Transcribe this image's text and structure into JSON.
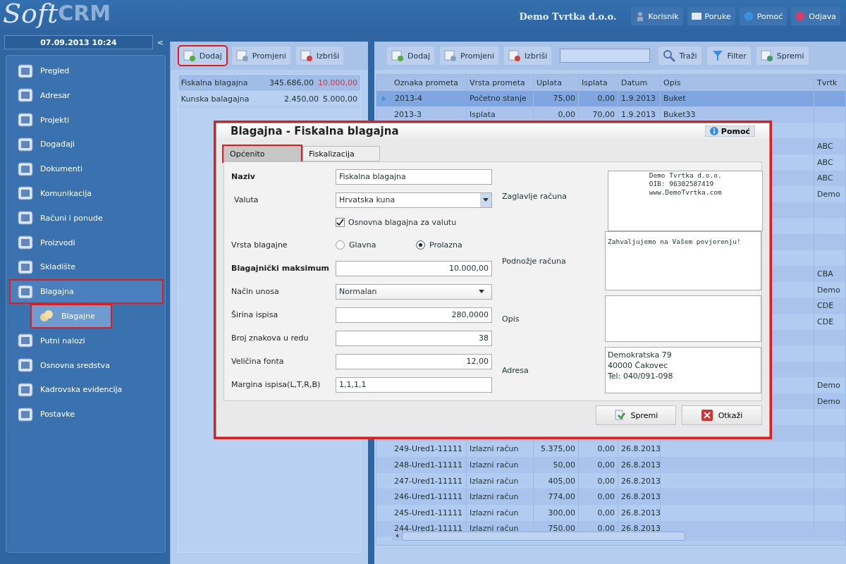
{
  "header": {
    "logo_script": "Soft",
    "logo_bold": "CRM",
    "company": "Demo Tvrtka d.o.o.",
    "buttons": [
      {
        "label": "Korisnik",
        "kind": "user"
      },
      {
        "label": "Poruke",
        "kind": "mail"
      },
      {
        "label": "Pomoć",
        "kind": "info"
      },
      {
        "label": "Odjava",
        "kind": "power"
      }
    ]
  },
  "sidebar": {
    "datetime": "07.09.2013 10:24",
    "collapse": "<",
    "items": [
      {
        "label": "Pregled",
        "selected": false,
        "highlighted": false
      },
      {
        "label": "Adresar",
        "selected": false,
        "highlighted": false
      },
      {
        "label": "Projekti",
        "selected": false,
        "highlighted": false
      },
      {
        "label": "Događaji",
        "selected": false,
        "highlighted": false
      },
      {
        "label": "Dokumenti",
        "selected": false,
        "highlighted": false
      },
      {
        "label": "Komunikacija",
        "selected": false,
        "highlighted": false
      },
      {
        "label": "Računi i ponude",
        "selected": false,
        "highlighted": false
      },
      {
        "label": "Proizvodi",
        "selected": false,
        "highlighted": false
      },
      {
        "label": "Skladište",
        "selected": false,
        "highlighted": false
      },
      {
        "label": "Blagajna",
        "selected": true,
        "highlighted": true,
        "children": [
          {
            "label": "Blagajne",
            "selected": true,
            "highlighted": true
          }
        ]
      },
      {
        "label": "Putni nalozi",
        "selected": false,
        "highlighted": false
      },
      {
        "label": "Osnovna sredstva",
        "selected": false,
        "highlighted": false
      },
      {
        "label": "Kadrovska evidencija",
        "selected": false,
        "highlighted": false
      },
      {
        "label": "Postavke",
        "selected": false,
        "highlighted": false
      }
    ]
  },
  "cashbox_panel": {
    "toolbar": [
      {
        "label": "Dodaj",
        "kind": "add",
        "highlighted": true
      },
      {
        "label": "Promjeni",
        "kind": "edit",
        "highlighted": false
      },
      {
        "label": "Izbriši",
        "kind": "delete",
        "highlighted": false
      }
    ],
    "items": [
      {
        "name": "Fiskalna blagajna",
        "balance": "345.686,00",
        "maximum": "10.000,00",
        "over_limit": true,
        "selected": true
      },
      {
        "name": "Kunska balagajna",
        "balance": "2.450,00",
        "maximum": "5.000,00",
        "over_limit": false,
        "selected": false
      }
    ]
  },
  "transactions": {
    "toolbar": [
      {
        "label": "Dodaj",
        "kind": "add"
      },
      {
        "label": "Promjeni",
        "kind": "edit"
      },
      {
        "label": "Izbriši",
        "kind": "delete"
      },
      {
        "kind": "search_field"
      },
      {
        "label": "Traži",
        "kind": "search"
      },
      {
        "label": "Filter",
        "kind": "filter"
      },
      {
        "label": "Spremi",
        "kind": "save"
      }
    ],
    "columns": [
      "Oznaka prometa",
      "Vrsta prometa",
      "Uplata",
      "Isplata",
      "Datum",
      "Opis",
      "Tvrtk"
    ],
    "rows": [
      {
        "selected": true,
        "cells": [
          "2013-4",
          "Početno stanje",
          "75,00",
          "0,00",
          "1.9.2013",
          "Buket"
        ]
      },
      {
        "selected": false,
        "cells": [
          "2013-3",
          "Isplata",
          "0,00",
          "70,00",
          "1.9.2013",
          "Buket33"
        ]
      },
      {
        "selected": false,
        "cells": []
      },
      {
        "selected": false,
        "tvrtka": "ABC"
      },
      {
        "selected": false,
        "tvrtka": "ABC"
      },
      {
        "selected": false,
        "tvrtka": "ABC"
      },
      {
        "selected": false,
        "tvrtka": "Demo"
      },
      {
        "selected": false
      },
      {
        "selected": false
      },
      {
        "selected": false
      },
      {
        "selected": false
      },
      {
        "selected": false,
        "tvrtka": "CBA"
      },
      {
        "selected": false,
        "tvrtka": "Demo"
      },
      {
        "selected": false,
        "tvrtka": "CDE"
      },
      {
        "selected": false,
        "tvrtka": "CDE"
      },
      {
        "selected": false
      },
      {
        "selected": false
      },
      {
        "selected": false
      },
      {
        "selected": false,
        "tvrtka": "Demo"
      },
      {
        "selected": false,
        "tvrtka": "Demo"
      },
      {
        "selected": false
      },
      {
        "selected": false
      },
      {
        "selected": false,
        "cells": [
          "249-Ured1-11111",
          "Izlazni račun",
          "5.375,00",
          "0,00",
          "26.8.2013"
        ]
      },
      {
        "selected": false,
        "cells": [
          "248-Ured1-11111",
          "Izlazni račun",
          "50,00",
          "0,00",
          "26.8.2013"
        ]
      },
      {
        "selected": false,
        "cells": [
          "247-Ured1-11111",
          "Izlazni račun",
          "405,00",
          "0,00",
          "26.8.2013"
        ]
      },
      {
        "selected": false,
        "cells": [
          "246-Ured1-11111",
          "Izlazni račun",
          "774,00",
          "0,00",
          "26.8.2013"
        ]
      },
      {
        "selected": false,
        "cells": [
          "245-Ured1-11111",
          "Izlazni račun",
          "300,00",
          "0,00",
          "26.8.2013"
        ]
      },
      {
        "selected": false,
        "cells": [
          "244-Ured1-11111",
          "Izlazni račun",
          "750,00",
          "0,00",
          "26.8.2013"
        ]
      }
    ]
  },
  "dialog": {
    "title": "Blagajna - Fiskalna blagajna",
    "help": "Pomoć",
    "highlighted": true,
    "tabs": [
      {
        "label": "Općenito",
        "selected": true,
        "highlighted": true
      },
      {
        "label": "Fiskalizacija",
        "selected": false,
        "highlighted": false
      }
    ],
    "fields": [
      {
        "kind": "text",
        "label": "Naziv",
        "required": true,
        "value": "Fiskalna blagajna"
      },
      {
        "kind": "select",
        "label": "Valuta",
        "required": false,
        "value": "Hrvatska kuna"
      },
      {
        "kind": "checkbox",
        "label": "Osnovna blagajna za valutu",
        "checked": true
      },
      {
        "kind": "radio",
        "label": "Vrsta blagajne",
        "required": false,
        "options": [
          {
            "label": "Glavna",
            "selected": false
          },
          {
            "label": "Prolazna",
            "selected": true
          }
        ]
      },
      {
        "kind": "number",
        "label": "Blagajnički maksimum",
        "required": true,
        "value": "10.000,00"
      },
      {
        "kind": "dropdown",
        "label": "Način unosa",
        "required": false,
        "value": "Normalan"
      },
      {
        "kind": "number",
        "label": "Širina ispisa",
        "required": false,
        "value": "280,0000"
      },
      {
        "kind": "number",
        "label": "Broj znakova u redu",
        "required": false,
        "value": "38"
      },
      {
        "kind": "number",
        "label": "Veličina fonta",
        "required": false,
        "value": "12,00"
      },
      {
        "kind": "text",
        "label": "Margina ispisa(L,T,R,B)",
        "required": false,
        "value": "1,1,1,1"
      }
    ],
    "text_areas": [
      {
        "label": "Zaglavlje računa",
        "value": "Demo Tvrtka d.o.o.\nOIB: 96302587419\nwww.DemoTvrtka.com",
        "kind": "receipt"
      },
      {
        "label": "Podnožje računa",
        "value": "Zahvaljujemo na Vašem povjerenju!",
        "kind": "receipt"
      },
      {
        "label": "Opis",
        "kind": "plain"
      },
      {
        "label": "Adresa",
        "value": "Demokratska 79\n40000 Čakovec\nTel: 040/091-098",
        "kind": "plain"
      }
    ],
    "buttons": [
      {
        "label": "Spremi",
        "kind": "save"
      },
      {
        "label": "Otkaži",
        "kind": "cancel"
      }
    ]
  }
}
